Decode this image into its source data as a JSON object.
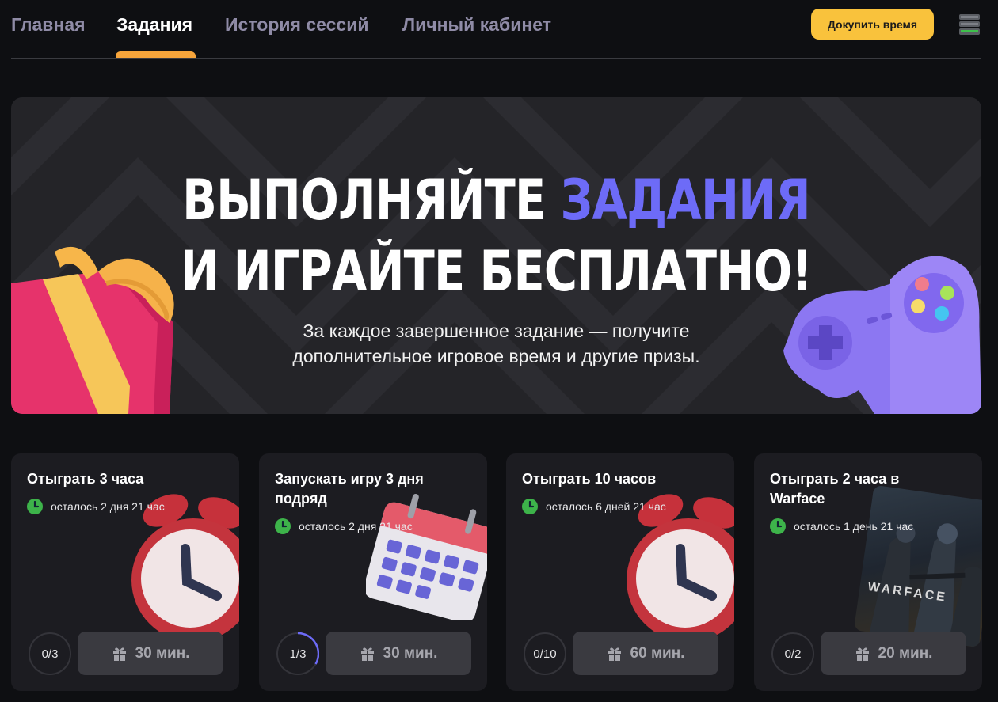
{
  "nav": {
    "tabs": [
      {
        "label": "Главная",
        "active": false
      },
      {
        "label": "Задания",
        "active": true
      },
      {
        "label": "История сессий",
        "active": false
      },
      {
        "label": "Личный кабинет",
        "active": false
      }
    ],
    "buy_button": "Докупить время",
    "server_icon": "server-status-icon"
  },
  "banner": {
    "headline_part1": "ВЫПОЛНЯЙТЕ ",
    "headline_accent": "ЗАДАНИЯ",
    "headline_line2": "И ИГРАЙТЕ БЕСПЛАТНО!",
    "subtitle_line1": "За каждое завершенное задание — получите",
    "subtitle_line2": "дополнительное игровое время и другие призы.",
    "accent_color": "#6d6bf7",
    "left_art": "gift-box",
    "right_art": "gamepad"
  },
  "quests": [
    {
      "title": "Отыграть 3 часа",
      "timer": "осталось 2 дня 21 час",
      "progress": "0/3",
      "progress_fraction": 0,
      "reward": "30 мин.",
      "art": "alarm-clock"
    },
    {
      "title": "Запускать игру 3 дня подряд",
      "timer": "осталось 2 дня 21 час",
      "progress": "1/3",
      "progress_fraction": 0.333,
      "reward": "30 мин.",
      "art": "calendar"
    },
    {
      "title": "Отыграть 10 часов",
      "timer": "осталось 6 дней 21 час",
      "progress": "0/10",
      "progress_fraction": 0,
      "reward": "60 мин.",
      "art": "alarm-clock"
    },
    {
      "title": "Отыграть 2 часа в Warface",
      "timer": "осталось 1 день 21 час",
      "progress": "0/2",
      "progress_fraction": 0,
      "reward": "20 мин.",
      "art": "warface-cover",
      "art_text": "WARFACE"
    }
  ],
  "colors": {
    "background": "#0e0f12",
    "card": "#1c1c21",
    "active_tab_underline": "#f7a53b",
    "buy_button": "#f9c23c",
    "timer_icon": "#3db34a",
    "progress_arc": "#6d6bf7"
  }
}
